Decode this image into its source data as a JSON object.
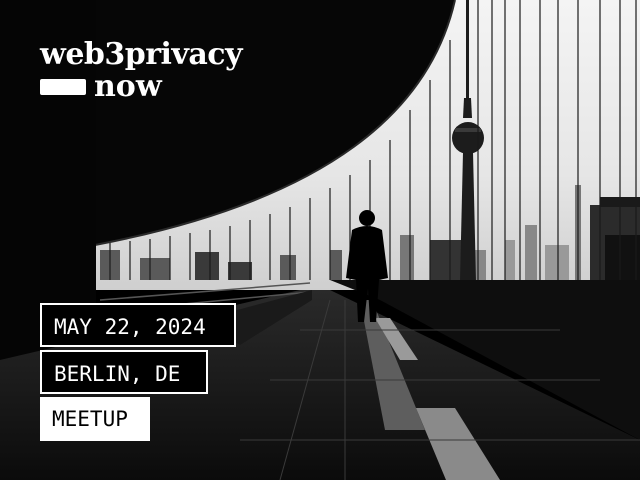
{
  "brand": {
    "name": "web3privacy",
    "suffix": "now"
  },
  "event": {
    "date": "MAY 22, 2024",
    "location": "BERLIN, DE",
    "type": "MEETUP"
  },
  "colors": {
    "background": "#000000",
    "text_light": "#ffffff",
    "sky": "#efefef"
  }
}
